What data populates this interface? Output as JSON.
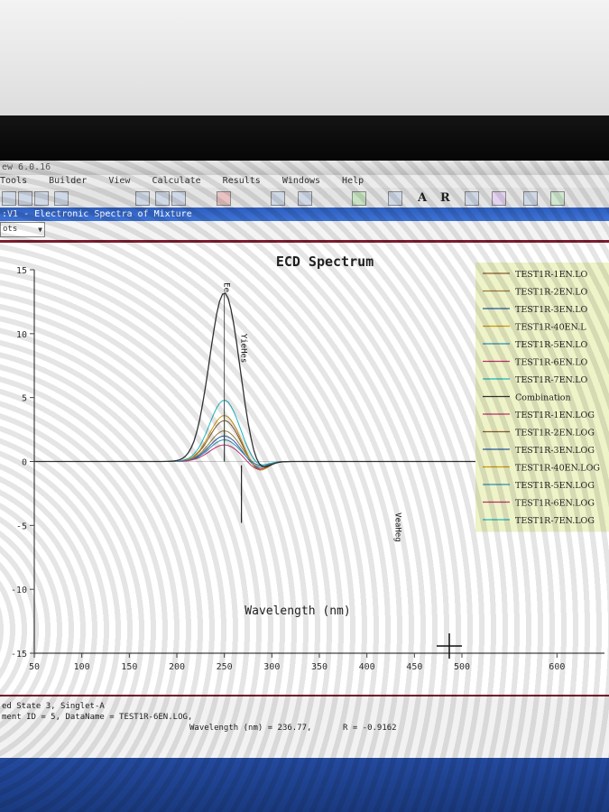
{
  "window": {
    "app_title": "ew 6.0.16",
    "menu": [
      "Tools",
      "Builder",
      "View",
      "Calculate",
      "Results",
      "Windows",
      "Help"
    ],
    "doc_title": ":V1 - Electronic Spectra of Mixture",
    "plot_selector": "ots"
  },
  "toolbar": {
    "a_label": "A",
    "r_label": "R"
  },
  "status": {
    "line1": "ed State 3, Singlet-A",
    "line2": "ment ID = 5, DataName = TEST1R-6EN.LOG,",
    "wavelength_readout": "Wavelength (nm) = 236.77,",
    "r_readout": "R = -0.9162"
  },
  "colors": {
    "frame": "#7a1d2e",
    "legend_bg": "#eef3c8",
    "combination": "#333333"
  },
  "chart_data": {
    "type": "line",
    "title": "ECD Spectrum",
    "xlabel": "Wavelength (nm)",
    "ylabel": "",
    "xlim": [
      50,
      650
    ],
    "ylim": [
      -15,
      15
    ],
    "x_ticks": [
      50,
      100,
      150,
      200,
      250,
      300,
      350,
      400,
      450,
      500,
      600
    ],
    "y_ticks": [
      15,
      10,
      5,
      0,
      -5,
      -10,
      -15
    ],
    "annotations": [
      {
        "text": "Ee",
        "x": 250,
        "y": 14
      },
      {
        "text": "YieHes",
        "x": 268,
        "y": 10
      },
      {
        "text": "VeaHeg",
        "x": 430,
        "y": -4
      }
    ],
    "series": [
      {
        "name": "TEST1R-1EN.LOG",
        "color": "#8a5a2b",
        "peak": 3.2,
        "neg": -0.8
      },
      {
        "name": "TEST1R-2EN.LOG",
        "color": "#9a7a3a",
        "peak": 2.4,
        "neg": -0.5
      },
      {
        "name": "TEST1R-3EN.LOG",
        "color": "#2a5aa0",
        "peak": 2.0,
        "neg": -0.6
      },
      {
        "name": "TEST1R-40EN.LOG",
        "color": "#c89a10",
        "peak": 3.6,
        "neg": -0.9
      },
      {
        "name": "TEST1R-5EN.LOG",
        "color": "#2a8fb8",
        "peak": 1.7,
        "neg": -0.4
      },
      {
        "name": "TEST1R-6EN.LOG",
        "color": "#c0306a",
        "peak": 1.3,
        "neg": -0.7
      },
      {
        "name": "TEST1R-7EN.LOG",
        "color": "#20b4c0",
        "peak": 4.8,
        "neg": -0.5
      },
      {
        "name": "Combination",
        "color": "#333333",
        "peak": 13.2,
        "neg": -1.0
      }
    ],
    "legend": [
      "TEST1R-1EN.LO",
      "TEST1R-2EN.LO",
      "TEST1R-3EN.LO",
      "TEST1R-40EN.L",
      "TEST1R-5EN.LO",
      "TEST1R-6EN.LO",
      "TEST1R-7EN.LO",
      "Combination",
      "TEST1R-1EN.LOG",
      "TEST1R-2EN.LOG",
      "TEST1R-3EN.LOG",
      "TEST1R-40EN.LOG",
      "TEST1R-5EN.LOG",
      "TEST1R-6EN.LOG",
      "TEST1R-7EN.LOG"
    ],
    "legend_colors": [
      "#8a5a2b",
      "#9a7a3a",
      "#2a5aa0",
      "#c89a10",
      "#2a8fb8",
      "#c0306a",
      "#20b4c0",
      "#333333",
      "#c0306a",
      "#8a5a2b",
      "#2a5aa0",
      "#c89a10",
      "#2a8fb8",
      "#c0306a",
      "#20b4c0"
    ]
  }
}
